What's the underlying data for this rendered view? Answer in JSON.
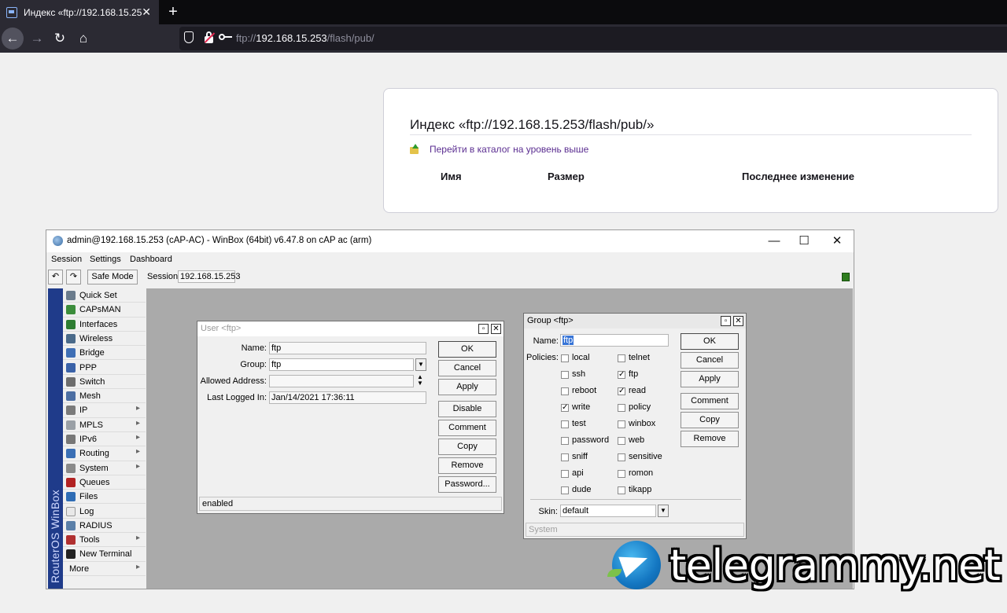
{
  "browser": {
    "tab_title": "Индекс «ftp://192.168.15.253/flash/pub/»",
    "url_scheme": "ftp://",
    "url_host": "192.168.15.253",
    "url_path": "/flash/pub/"
  },
  "ftp_index": {
    "title": "Индекс «ftp://192.168.15.253/flash/pub/»",
    "up_link": "Перейти в каталог на уровень выше",
    "columns": [
      "Имя",
      "Размер",
      "Последнее изменение"
    ]
  },
  "winbox": {
    "title": "admin@192.168.15.253 (cAP-AC) - WinBox (64bit) v6.47.8 on cAP ac (arm)",
    "menu": [
      "Session",
      "Settings",
      "Dashboard"
    ],
    "safe_mode": "Safe Mode",
    "session_label": "Session:",
    "session_value": "192.168.15.253",
    "brand_vertical": "RouterOS WinBox",
    "sidebar": [
      {
        "label": "Quick Set",
        "icon": "quick-set-icon",
        "color": "#6a7b8c",
        "arrow": false
      },
      {
        "label": "CAPsMAN",
        "icon": "capsman-icon",
        "color": "#3c8d3c",
        "arrow": false
      },
      {
        "label": "Interfaces",
        "icon": "interfaces-icon",
        "color": "#2e7d32",
        "arrow": false
      },
      {
        "label": "Wireless",
        "icon": "wireless-icon",
        "color": "#4a6a8a",
        "arrow": false
      },
      {
        "label": "Bridge",
        "icon": "bridge-icon",
        "color": "#3f6fb5",
        "arrow": false
      },
      {
        "label": "PPP",
        "icon": "ppp-icon",
        "color": "#3a62a8",
        "arrow": false
      },
      {
        "label": "Switch",
        "icon": "switch-icon",
        "color": "#6d6d6d",
        "arrow": false
      },
      {
        "label": "Mesh",
        "icon": "mesh-icon",
        "color": "#4d6fa3",
        "arrow": false
      },
      {
        "label": "IP",
        "icon": "ip-icon",
        "color": "#7a7a7a",
        "arrow": true
      },
      {
        "label": "MPLS",
        "icon": "mpls-icon",
        "color": "#9aa0a6",
        "arrow": true
      },
      {
        "label": "IPv6",
        "icon": "ipv6-icon",
        "color": "#777777",
        "arrow": true
      },
      {
        "label": "Routing",
        "icon": "routing-icon",
        "color": "#3a6fb5",
        "arrow": true
      },
      {
        "label": "System",
        "icon": "system-icon",
        "color": "#8a8a8a",
        "arrow": true
      },
      {
        "label": "Queues",
        "icon": "queues-icon",
        "color": "#b22222",
        "arrow": false
      },
      {
        "label": "Files",
        "icon": "files-icon",
        "color": "#2f6db5",
        "arrow": false
      },
      {
        "label": "Log",
        "icon": "log-icon",
        "color": "#e8e8e8",
        "arrow": false
      },
      {
        "label": "RADIUS",
        "icon": "radius-icon",
        "color": "#5a7fa8",
        "arrow": false
      },
      {
        "label": "Tools",
        "icon": "tools-icon",
        "color": "#b03030",
        "arrow": true
      },
      {
        "label": "New Terminal",
        "icon": "terminal-icon",
        "color": "#222222",
        "arrow": false
      },
      {
        "label": "More",
        "icon": "",
        "color": "",
        "arrow": true
      }
    ]
  },
  "user_dialog": {
    "title": "User <ftp>",
    "fields": {
      "name_label": "Name:",
      "name_value": "ftp",
      "group_label": "Group:",
      "group_value": "ftp",
      "allowed_label": "Allowed Address:",
      "allowed_value": "",
      "last_label": "Last Logged In:",
      "last_value": "Jan/14/2021 17:36:11"
    },
    "buttons": [
      "OK",
      "Cancel",
      "Apply",
      "Disable",
      "Comment",
      "Copy",
      "Remove",
      "Password..."
    ],
    "status": "enabled"
  },
  "group_dialog": {
    "title": "Group <ftp>",
    "name_label": "Name:",
    "name_value": "ftp",
    "policies_label": "Policies:",
    "policies_left": [
      {
        "label": "local",
        "checked": false
      },
      {
        "label": "ssh",
        "checked": false
      },
      {
        "label": "reboot",
        "checked": false
      },
      {
        "label": "write",
        "checked": true
      },
      {
        "label": "test",
        "checked": false
      },
      {
        "label": "password",
        "checked": false
      },
      {
        "label": "sniff",
        "checked": false
      },
      {
        "label": "api",
        "checked": false
      },
      {
        "label": "dude",
        "checked": false
      }
    ],
    "policies_right": [
      {
        "label": "telnet",
        "checked": false
      },
      {
        "label": "ftp",
        "checked": true
      },
      {
        "label": "read",
        "checked": true
      },
      {
        "label": "policy",
        "checked": false
      },
      {
        "label": "winbox",
        "checked": false
      },
      {
        "label": "web",
        "checked": false
      },
      {
        "label": "sensitive",
        "checked": false
      },
      {
        "label": "romon",
        "checked": false
      },
      {
        "label": "tikapp",
        "checked": false
      }
    ],
    "skin_label": "Skin:",
    "skin_value": "default",
    "buttons": [
      "OK",
      "Cancel",
      "Apply",
      "Comment",
      "Copy",
      "Remove"
    ],
    "status": "System"
  },
  "watermark": "telegrammy.net"
}
